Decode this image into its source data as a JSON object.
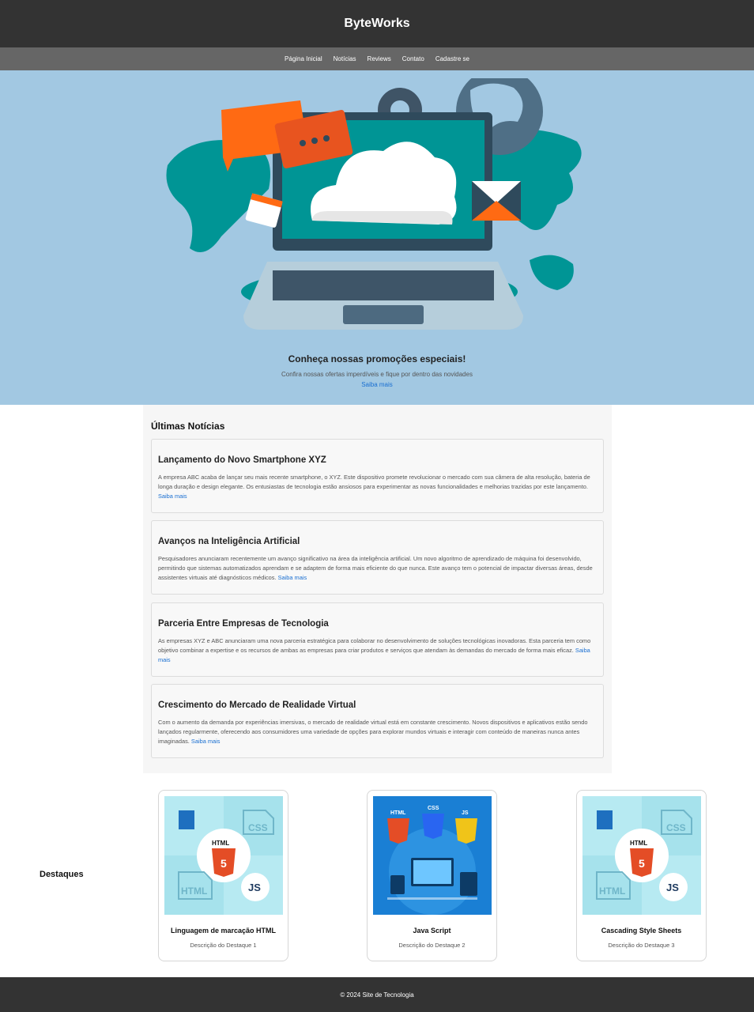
{
  "header": {
    "title": "ByteWorks"
  },
  "nav": {
    "items": [
      "Página Inicial",
      "Notícias",
      "Reviews",
      "Contato",
      "Cadastre se"
    ]
  },
  "hero": {
    "title": "Conheça nossas promoções especiais!",
    "subtitle": "Confira nossas ofertas imperdíveis e fique por dentro das novidades",
    "link": "Saiba mais",
    "colors": {
      "background": "#a2c8e2",
      "screen": "#009595",
      "laptop": "#2f4a5c"
    }
  },
  "news": {
    "heading": "Últimas Notícias",
    "articles": [
      {
        "title": "Lançamento do Novo Smartphone XYZ",
        "body": "A empresa ABC acaba de lançar seu mais recente smartphone, o XYZ. Este dispositivo promete revolucionar o mercado com sua câmera de alta resolução, bateria de longa duração e design elegante. Os entusiastas de tecnologia estão ansiosos para experimentar as novas funcionalidades e melhorias trazidas por este lançamento.",
        "link": "Saiba mais"
      },
      {
        "title": "Avanços na Inteligência Artificial",
        "body": "Pesquisadores anunciaram recentemente um avanço significativo na área da inteligência artificial. Um novo algoritmo de aprendizado de máquina foi desenvolvido, permitindo que sistemas automatizados aprendam e se adaptem de forma mais eficiente do que nunca. Este avanço tem o potencial de impactar diversas áreas, desde assistentes virtuais até diagnósticos médicos.",
        "link": "Saiba mais"
      },
      {
        "title": "Parceria Entre Empresas de Tecnologia",
        "body": "As empresas XYZ e ABC anunciaram uma nova parceria estratégica para colaborar no desenvolvimento de soluções tecnológicas inovadoras. Esta parceria tem como objetivo combinar a expertise e os recursos de ambas as empresas para criar produtos e serviços que atendam às demandas do mercado de forma mais eficaz.",
        "link": "Saiba mais"
      },
      {
        "title": "Crescimento do Mercado de Realidade Virtual",
        "body": "Com o aumento da demanda por experiências imersivas, o mercado de realidade virtual está em constante crescimento. Novos dispositivos e aplicativos estão sendo lançados regularmente, oferecendo aos consumidores uma variedade de opções para explorar mundos virtuais e interagir com conteúdo de maneiras nunca antes imaginadas.",
        "link": "Saiba mais"
      }
    ]
  },
  "highlights": {
    "label": "Destaques",
    "cards": [
      {
        "title": "Linguagem de marcação HTML",
        "desc": "Descrição do Destaque 1",
        "image_labels": [
          "HTML",
          "CSS",
          "JS",
          "HTML"
        ]
      },
      {
        "title": "Java Script",
        "desc": "Descrição do Destaque 2",
        "image_labels": [
          "HTML",
          "CSS",
          "JS"
        ]
      },
      {
        "title": "Cascading Style Sheets",
        "desc": "Descrição do Destaque 3",
        "image_labels": [
          "HTML",
          "CSS",
          "JS",
          "HTML"
        ]
      }
    ]
  },
  "footer": {
    "text": "© 2024 Site de Tecnologia"
  }
}
